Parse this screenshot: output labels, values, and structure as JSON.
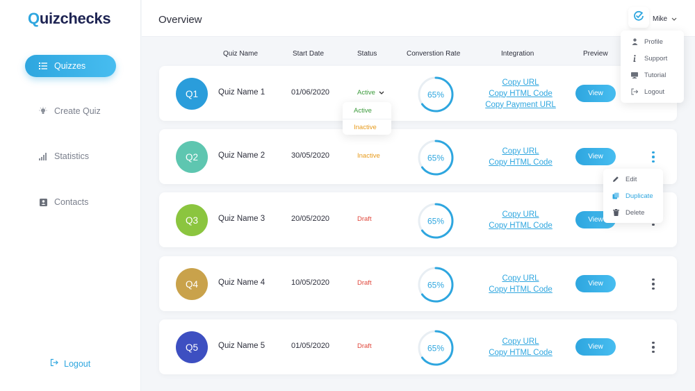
{
  "app": {
    "logo_prefix": "Q",
    "logo_rest": "uizchecks"
  },
  "sidebar": {
    "items": [
      {
        "label": "Quizzes",
        "icon": "list-icon"
      },
      {
        "label": "Create Quiz",
        "icon": "lightbulb-icon"
      },
      {
        "label": "Statistics",
        "icon": "bar-chart-icon"
      },
      {
        "label": "Contacts",
        "icon": "contact-card-icon"
      }
    ],
    "logout_label": "Logout"
  },
  "header": {
    "title": "Overview",
    "user_name": "Mike"
  },
  "user_menu": {
    "items": [
      {
        "label": "Profile",
        "icon": "person-icon"
      },
      {
        "label": "Support",
        "icon": "info-icon"
      },
      {
        "label": "Tutorial",
        "icon": "monitor-icon"
      },
      {
        "label": "Logout",
        "icon": "logout-icon"
      }
    ]
  },
  "table": {
    "columns": [
      "Quiz Name",
      "Start Date",
      "Status",
      "Converstion Rate",
      "Integration",
      "Preview"
    ],
    "rows": [
      {
        "badge": "Q1",
        "name": "Quiz Name 1",
        "date": "01/06/2020",
        "status": "Active",
        "rate": "65%",
        "links": [
          "Copy URL",
          "Copy HTML Code",
          "Copy Payment URL"
        ],
        "view": "View"
      },
      {
        "badge": "Q2",
        "name": "Quiz Name 2",
        "date": "30/05/2020",
        "status": "Inactive",
        "rate": "65%",
        "links": [
          "Copy URL",
          "Copy HTML Code"
        ],
        "view": "View"
      },
      {
        "badge": "Q3",
        "name": "Quiz Name 3",
        "date": "20/05/2020",
        "status": "Draft",
        "rate": "65%",
        "links": [
          "Copy URL",
          "Copy HTML Code"
        ],
        "view": "View"
      },
      {
        "badge": "Q4",
        "name": "Quiz Name 4",
        "date": "10/05/2020",
        "status": "Draft",
        "rate": "65%",
        "links": [
          "Copy URL",
          "Copy HTML Code"
        ],
        "view": "View"
      },
      {
        "badge": "Q5",
        "name": "Quiz Name 5",
        "date": "01/05/2020",
        "status": "Draft",
        "rate": "65%",
        "links": [
          "Copy URL",
          "Copy HTML Code"
        ],
        "view": "View"
      }
    ]
  },
  "status_menu": {
    "items": [
      "Active",
      "Inactive"
    ]
  },
  "row_menu": {
    "items": [
      {
        "label": "Edit",
        "icon": "pencil-icon"
      },
      {
        "label": "Duplicate",
        "icon": "copy-icon"
      },
      {
        "label": "Delete",
        "icon": "trash-icon"
      }
    ]
  },
  "conversion_progress": 0.65,
  "colors": {
    "accent": "#2ea6df",
    "q1": "#2a9ddb",
    "q2": "#5ec6b0",
    "q3": "#8bc53f",
    "q4": "#c9a24b",
    "q5": "#3d4fc1",
    "active": "#3a9a3a",
    "inactive": "#e79a1a",
    "draft": "#e0463a",
    "kebab": "#555a66",
    "kebab_active": "#2ea6df"
  }
}
